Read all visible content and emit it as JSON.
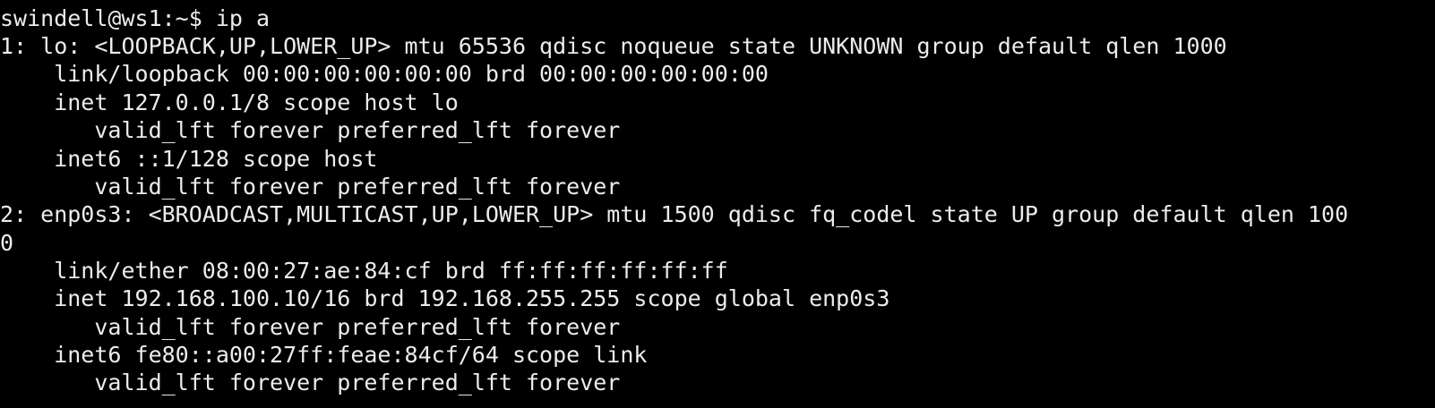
{
  "terminal": {
    "prompt": "swindell@ws1:~$ ip a",
    "lines": [
      "1: lo: <LOOPBACK,UP,LOWER_UP> mtu 65536 qdisc noqueue state UNKNOWN group default qlen 1000",
      "    link/loopback 00:00:00:00:00:00 brd 00:00:00:00:00:00",
      "    inet 127.0.0.1/8 scope host lo",
      "       valid_lft forever preferred_lft forever",
      "    inet6 ::1/128 scope host",
      "       valid_lft forever preferred_lft forever",
      "2: enp0s3: <BROADCAST,MULTICAST,UP,LOWER_UP> mtu 1500 qdisc fq_codel state UP group default qlen 100",
      "0",
      "    link/ether 08:00:27:ae:84:cf brd ff:ff:ff:ff:ff:ff",
      "    inet 192.168.100.10/16 brd 192.168.255.255 scope global enp0s3",
      "       valid_lft forever preferred_lft forever",
      "    inet6 fe80::a00:27ff:feae:84cf/64 scope link",
      "       valid_lft forever preferred_lft forever"
    ]
  },
  "colors": {
    "background": "#000000",
    "foreground": "#ececec"
  }
}
